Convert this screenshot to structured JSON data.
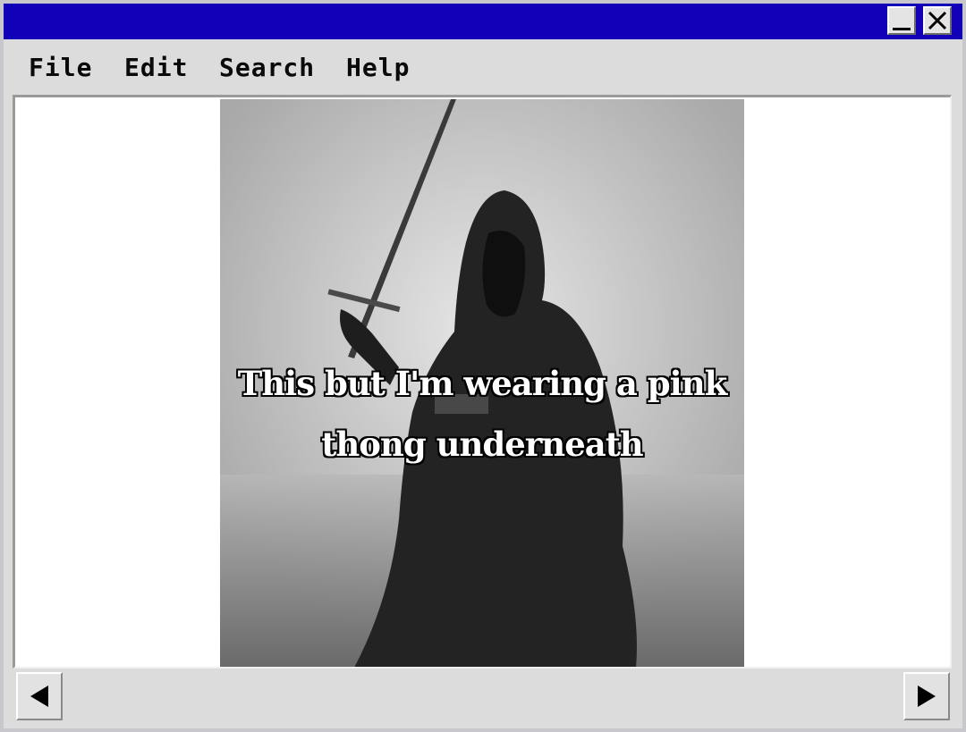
{
  "window": {
    "title_bar_color": "#1200b8",
    "controls": {
      "minimize_icon": "minimize-icon",
      "close_icon": "close-icon"
    }
  },
  "menu": {
    "items": [
      {
        "label": "File"
      },
      {
        "label": "Edit"
      },
      {
        "label": "Search"
      },
      {
        "label": "Help"
      }
    ]
  },
  "content": {
    "image": {
      "description_icon": "hooded-figure-with-sword-image",
      "caption_lines": [
        "This but I'm wearing a pink",
        "thong underneath"
      ]
    }
  },
  "scrollbar": {
    "left_icon": "arrow-left-icon",
    "right_icon": "arrow-right-icon"
  }
}
